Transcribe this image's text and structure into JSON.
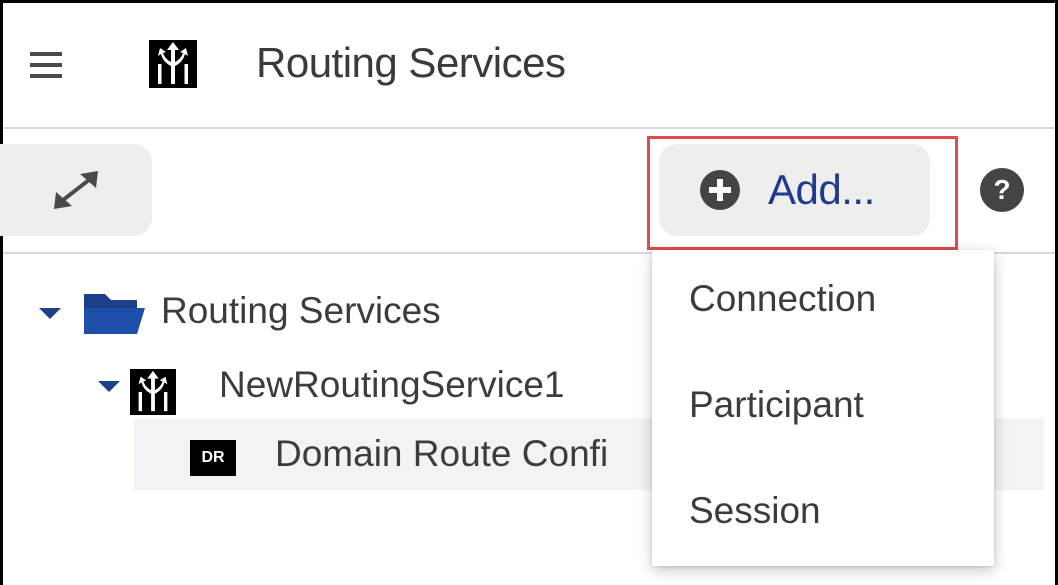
{
  "header": {
    "menu_icon": "hamburger-icon",
    "logo_icon": "routing-service-icon",
    "title": "Routing Services"
  },
  "toolbar": {
    "expand_icon": "expand-arrows-icon",
    "add_icon": "plus-circle-icon",
    "add_label": "Add...",
    "help_icon": "help-circle-icon"
  },
  "tree": {
    "root": {
      "label": "Routing Services",
      "icon": "folder-open-icon",
      "expanded": true
    },
    "service": {
      "label": "NewRoutingService1",
      "icon": "routing-service-icon",
      "expanded": true
    },
    "child": {
      "label": "Domain Route Confi",
      "badge": "DR",
      "selected": true
    }
  },
  "add_menu": {
    "items": [
      {
        "label": "Connection"
      },
      {
        "label": "Participant"
      },
      {
        "label": "Session"
      }
    ]
  },
  "colors": {
    "accent": "#1f3a8a",
    "highlight_border": "#e04b4f",
    "button_bg": "#eeeeee",
    "selected_row_bg": "#f2f3f7"
  }
}
